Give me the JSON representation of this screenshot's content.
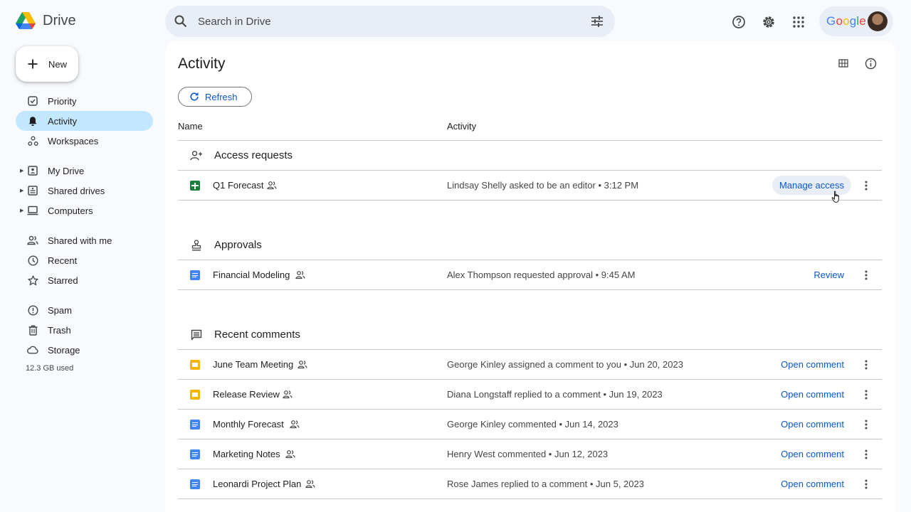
{
  "app": {
    "name": "Drive"
  },
  "search": {
    "placeholder": "Search in Drive"
  },
  "account": {
    "label": "Google"
  },
  "new_button": {
    "label": "New"
  },
  "sidebar": {
    "items": [
      {
        "label": "Priority",
        "icon": "priority-icon"
      },
      {
        "label": "Activity",
        "icon": "bell-icon",
        "active": true
      },
      {
        "label": "Workspaces",
        "icon": "workspaces-icon"
      },
      {
        "label": "My Drive",
        "icon": "my-drive-icon"
      },
      {
        "label": "Shared drives",
        "icon": "shared-drives-icon"
      },
      {
        "label": "Computers",
        "icon": "computer-icon"
      },
      {
        "label": "Shared with me",
        "icon": "people-icon"
      },
      {
        "label": "Recent",
        "icon": "clock-icon"
      },
      {
        "label": "Starred",
        "icon": "star-icon"
      },
      {
        "label": "Spam",
        "icon": "spam-icon"
      },
      {
        "label": "Trash",
        "icon": "trash-icon"
      },
      {
        "label": "Storage",
        "icon": "cloud-icon"
      }
    ],
    "storage_used": "12.3 GB used"
  },
  "main": {
    "title": "Activity",
    "refresh_label": "Refresh",
    "columns": {
      "name": "Name",
      "activity": "Activity"
    },
    "sections": [
      {
        "title": "Access requests",
        "rows": [
          {
            "name": "Q1 Forecast",
            "type": "sheet",
            "activity": "Lindsay Shelly asked to be an editor • 3:12 PM",
            "action": "Manage access"
          }
        ]
      },
      {
        "title": "Approvals",
        "rows": [
          {
            "name": "Financial Modeling",
            "type": "doc",
            "activity": "Alex Thompson requested approval • 9:45 AM",
            "action": "Review"
          }
        ]
      },
      {
        "title": "Recent comments",
        "rows": [
          {
            "name": "June Team Meeting",
            "type": "slide",
            "activity": "George Kinley assigned a comment to you • Jun 20, 2023",
            "action": "Open comment"
          },
          {
            "name": "Release Review",
            "type": "slide",
            "activity": "Diana Longstaff replied to a comment • Jun 19, 2023",
            "action": "Open comment"
          },
          {
            "name": "Monthly Forecast",
            "type": "doc",
            "activity": "George Kinley commented • Jun 14, 2023",
            "action": "Open comment"
          },
          {
            "name": "Marketing Notes",
            "type": "doc",
            "activity": "Henry West commented • Jun 12, 2023",
            "action": "Open comment"
          },
          {
            "name": "Leonardi Project Plan",
            "type": "doc",
            "activity": "Rose James replied to a comment • Jun 5, 2023",
            "action": "Open comment"
          }
        ]
      }
    ]
  },
  "colors": {
    "accent": "#0b57d0",
    "active_nav": "#c2e7ff",
    "search_bg": "#e9eef6"
  }
}
